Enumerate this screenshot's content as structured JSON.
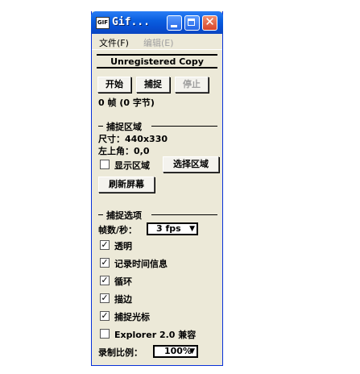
{
  "window": {
    "title": "Gif..."
  },
  "titlebar_buttons": {
    "minimize": "minimize",
    "maximize": "maximize",
    "close": "close"
  },
  "menu": {
    "file": "文件(F)",
    "edit": "编辑(E)"
  },
  "status": "Unregistered Copy",
  "controls": {
    "start": "开始",
    "capture": "捕捉",
    "stop": "停止"
  },
  "frames_info": "0 帧 (0 字节)",
  "capture_area": {
    "heading": "捕捉区域",
    "size": "尺寸：440x330",
    "top_left": "左上角：0,0",
    "show_area": "显示区域",
    "show_area_checked": false,
    "select_area": "选择区域",
    "refresh": "刷新屏幕"
  },
  "capture_options": {
    "heading": "捕捉选项",
    "fps_label": "帧数/秒：",
    "fps_value": "3 fps",
    "options": [
      {
        "label": "透明",
        "checked": true
      },
      {
        "label": "记录时间信息",
        "checked": true
      },
      {
        "label": "循环",
        "checked": true
      },
      {
        "label": "描边",
        "checked": true
      },
      {
        "label": "捕捉光标",
        "checked": true
      },
      {
        "label": "Explorer 2.0 兼容",
        "checked": false
      }
    ],
    "scale_label": "录制比例：",
    "scale_value": "100%"
  }
}
